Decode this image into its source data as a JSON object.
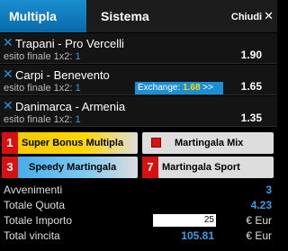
{
  "tabs": {
    "multipla": "Multipla",
    "sistema": "Sistema",
    "close": "Chiudi"
  },
  "bets": [
    {
      "match": "Trapani - Pro Vercelli",
      "desc": "esito finale 1x2:",
      "pick": "1",
      "odd": "1.90"
    },
    {
      "match": "Carpi - Benevento",
      "desc": "esito finale 1x2:",
      "pick": "1",
      "odd": "1.65",
      "exchange_label": "Exchange:",
      "exchange_value": "1.68",
      "exchange_arrow": ">>"
    },
    {
      "match": "Danimarca - Armenia",
      "desc": "esito finale 1x2:",
      "pick": "1",
      "odd": "1.35"
    }
  ],
  "promos": [
    {
      "badge": "1",
      "label": "Super Bonus Multipla"
    },
    {
      "label": "Martingala Mix"
    },
    {
      "badge": "3",
      "label": "Speedy Martingala"
    },
    {
      "badge": "7",
      "label": "Martingala Sport"
    }
  ],
  "summary": {
    "avvenimenti_label": "Avvenimenti",
    "avvenimenti": "3",
    "quota_label": "Totale Quota",
    "quota": "4.23",
    "importo_label": "Totale Importo",
    "importo": "25",
    "currency": "€ Eur",
    "vincita_label": "Total vincita",
    "vincita": "105.81"
  }
}
